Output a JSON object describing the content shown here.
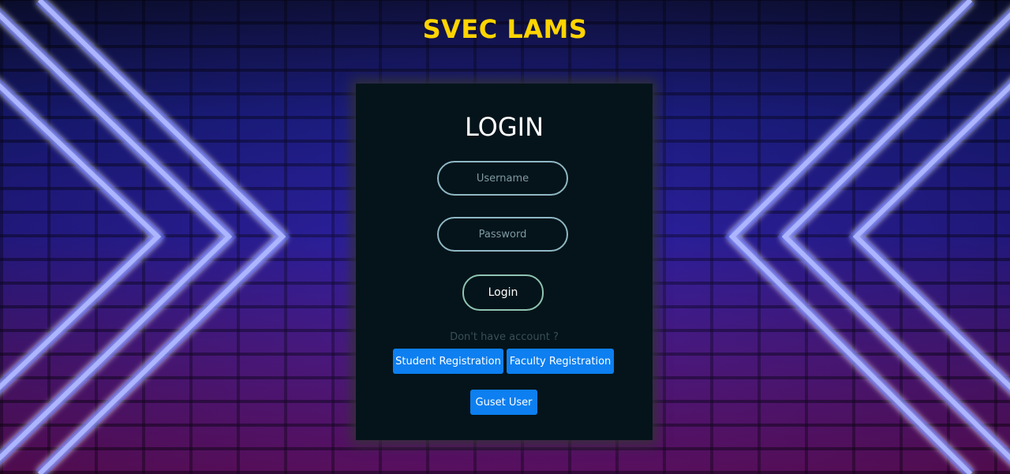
{
  "app": {
    "title": "SVEC LAMS"
  },
  "login_card": {
    "heading": "LOGIN",
    "username_placeholder": "Username",
    "password_placeholder": "Password",
    "login_label": "Login",
    "no_account_text": "Don't have account ?",
    "student_registration_label": "Student Registration",
    "faculty_registration_label": "Faculty Registration",
    "guest_user_label": "Guset User"
  },
  "colors": {
    "title": "#ffd400",
    "card_background": "#05141a",
    "button_blue": "#0d7ff0",
    "neon": "#ffffff"
  },
  "background": {
    "icon": "neon-chevron-brick-wall"
  }
}
